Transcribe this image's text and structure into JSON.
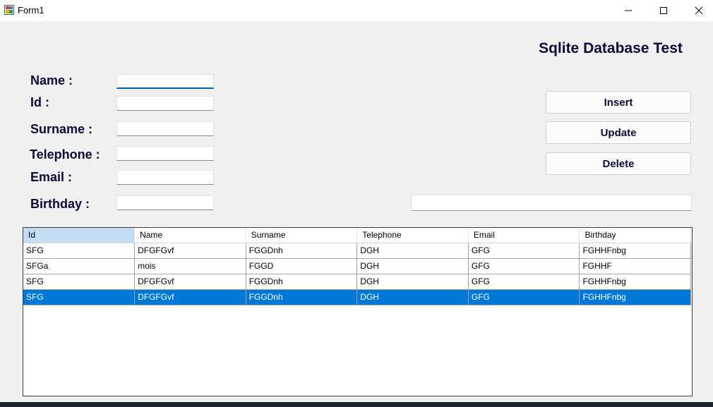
{
  "window": {
    "title": "Form1"
  },
  "heading": "Sqlite Database Test",
  "form": {
    "name_label": "Name :",
    "id_label": "Id :",
    "surname_label": "Surname :",
    "telephone_label": "Telephone :",
    "email_label": "Email :",
    "birthday_label": "Birthday :",
    "name_value": "",
    "id_value": "",
    "surname_value": "",
    "telephone_value": "",
    "email_value": "",
    "birthday_value": ""
  },
  "buttons": {
    "insert": "Insert",
    "update": "Update",
    "delete": "Delete"
  },
  "search_value": "",
  "grid": {
    "columns": [
      "Id",
      "Name",
      "Surname",
      "Telephone",
      "Email",
      "Birthday"
    ],
    "rows": [
      [
        "SFG",
        "DFGFGvf",
        "FGGDnh",
        "DGH",
        "GFG",
        "FGHHFnbg"
      ],
      [
        "SFGa",
        "mois",
        "FGGD",
        "DGH",
        "GFG",
        "FGHHF"
      ],
      [
        "SFG",
        "DFGFGvf",
        "FGGDnh",
        "DGH",
        "GFG",
        "FGHHFnbg"
      ],
      [
        "SFG",
        "DFGFGvf",
        "FGGDnh",
        "DGH",
        "GFG",
        "FGHHFnbg"
      ]
    ],
    "selected_row": 3
  },
  "colors": {
    "selection": "#0078d7",
    "label_text": "#0a0a3c"
  }
}
